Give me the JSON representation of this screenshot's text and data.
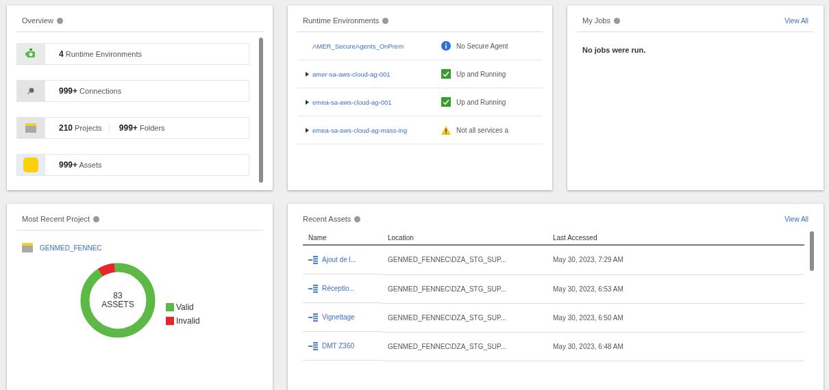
{
  "overview": {
    "title": "Overview",
    "items": [
      {
        "kind": "runtime",
        "parts": [
          "**4** Runtime Environments"
        ]
      },
      {
        "kind": "connection",
        "parts": [
          "**999+** Connections"
        ]
      },
      {
        "kind": "project",
        "parts": [
          "**210** Projects",
          "**999+** Folders"
        ]
      },
      {
        "kind": "asset",
        "parts": [
          "**999+** Assets"
        ]
      }
    ]
  },
  "runtime_environments": {
    "title": "Runtime Environments",
    "rows": [
      {
        "name": "AMER_SecureAgents_OnPrem",
        "expandable": false,
        "kind": "info",
        "status": "No Secure Agent"
      },
      {
        "name": "amer-sa-aws-cloud-ag-001",
        "expandable": true,
        "kind": "ok",
        "status": "Up and Running"
      },
      {
        "name": "emea-sa-aws-cloud-ag-001",
        "expandable": true,
        "kind": "ok",
        "status": "Up and Running"
      },
      {
        "name": "emea-sa-aws-cloud-ag-mass-ing",
        "expandable": true,
        "kind": "warning",
        "status": "Not all services a"
      }
    ]
  },
  "my_jobs": {
    "title": "My Jobs",
    "link": "View All",
    "message": "No jobs were run."
  },
  "most_recent_project": {
    "title": "Most Recent Project",
    "project": "GENMED_FENNEC",
    "count": "83",
    "count_label": "ASSETS",
    "legend": [
      {
        "label": "Valid",
        "color": "#5cb946"
      },
      {
        "label": "Invalid",
        "color": "#e8262a"
      }
    ]
  },
  "recent_assets": {
    "title": "Recent Assets",
    "link": "View All",
    "columns": [
      "Name",
      "Location",
      "Last Accessed"
    ],
    "rows": [
      {
        "name": "Ajout de l...",
        "location": "GENMED_FENNEC\\DZA_STG_SUP...",
        "accessed": "May 30, 2023, 7:29 AM"
      },
      {
        "name": "Réceptio...",
        "location": "GENMED_FENNEC\\DZA_STG_SUP...",
        "accessed": "May 30, 2023, 6:53 AM"
      },
      {
        "name": "Vignettage",
        "location": "GENMED_FENNEC\\DZA_STG_SUP...",
        "accessed": "May 30, 2023, 6:50 AM"
      },
      {
        "name": "DMT Z360",
        "location": "GENMED_FENNEC\\DZA_STG_SUP...",
        "accessed": "May 30, 2023, 6:48 AM"
      }
    ]
  }
}
